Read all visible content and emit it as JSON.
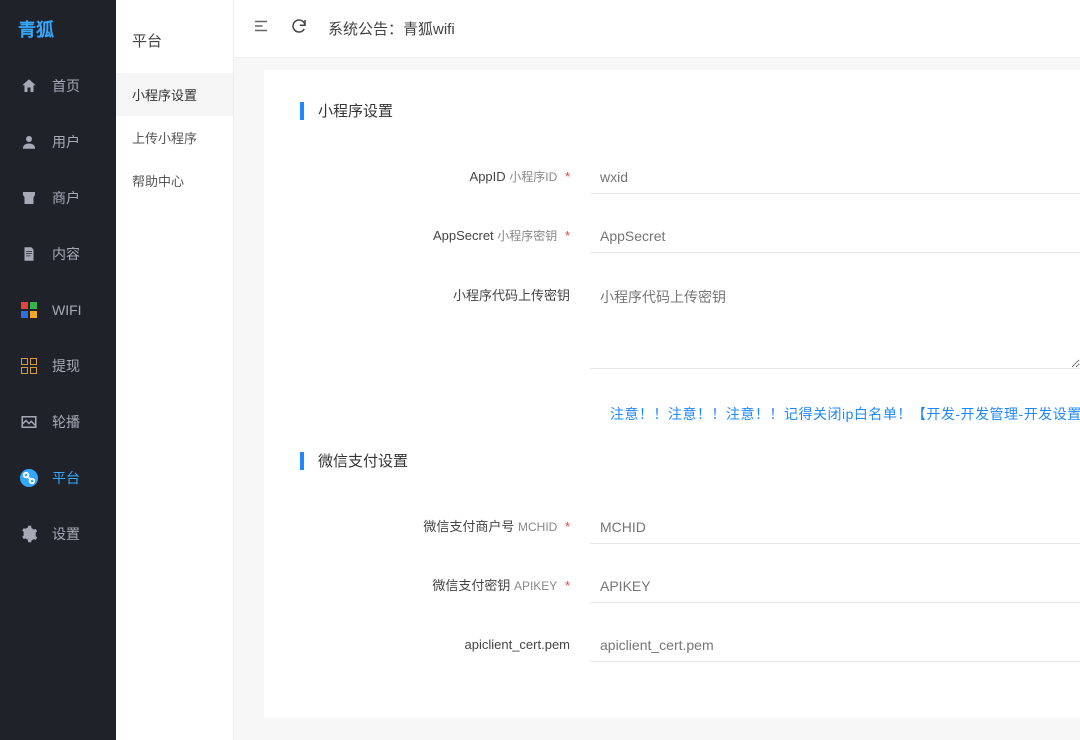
{
  "brand": "青狐",
  "topbar": {
    "notice_prefix": "系统公告：",
    "notice_text": "青狐wifi"
  },
  "leftnav": {
    "items": [
      {
        "label": "首页"
      },
      {
        "label": "用户"
      },
      {
        "label": "商户"
      },
      {
        "label": "内容"
      },
      {
        "label": "WIFI"
      },
      {
        "label": "提现"
      },
      {
        "label": "轮播"
      },
      {
        "label": "平台"
      },
      {
        "label": "设置"
      }
    ]
  },
  "subnav": {
    "title": "平台",
    "items": [
      {
        "label": "小程序设置"
      },
      {
        "label": "上传小程序"
      },
      {
        "label": "帮助中心"
      }
    ]
  },
  "section1": {
    "title": "小程序设置",
    "fields": {
      "appid": {
        "label_main": "AppID",
        "label_sub": "小程序ID",
        "placeholder": "wxid"
      },
      "secret": {
        "label_main": "AppSecret",
        "label_sub": "小程序密钥",
        "placeholder": "AppSecret"
      },
      "codekey": {
        "label_main": "小程序代码上传密钥",
        "placeholder": "小程序代码上传密钥"
      }
    },
    "warning": "注意！！注意！！注意！！记得关闭ip白名单！【开发-开发管理-开发设置-小程序代"
  },
  "section2": {
    "title": "微信支付设置",
    "fields": {
      "mchid": {
        "label_main": "微信支付商户号",
        "label_sub": "MCHID",
        "placeholder": "MCHID"
      },
      "apikey": {
        "label_main": "微信支付密钥",
        "label_sub": "APIKEY",
        "placeholder": "APIKEY"
      },
      "cert": {
        "label_main": "apiclient_cert.pem",
        "placeholder": "apiclient_cert.pem"
      }
    }
  }
}
